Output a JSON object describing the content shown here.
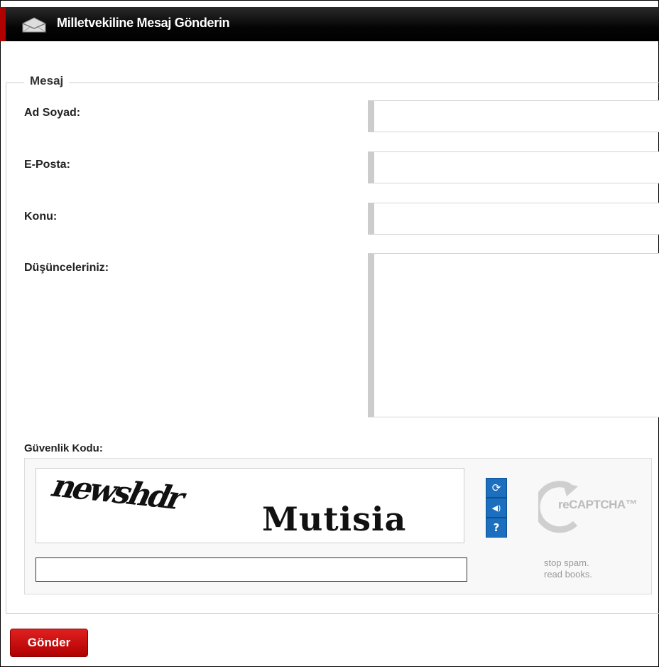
{
  "header": {
    "title": "Milletvekiline Mesaj Gönderin",
    "icon": "envelope-icon"
  },
  "form": {
    "legend": "Mesaj",
    "fields": [
      {
        "label": "Ad Soyad:",
        "value": "",
        "placeholder": ""
      },
      {
        "label": "E-Posta:",
        "value": "",
        "placeholder": ""
      },
      {
        "label": "Konu:",
        "value": "",
        "placeholder": ""
      },
      {
        "label": "Düşünceleriniz:",
        "value": "",
        "placeholder": ""
      }
    ],
    "captcha": {
      "label": "Güvenlik Kodu:",
      "word1": "newshdr",
      "word2": "Mutisia",
      "input_value": "",
      "buttons": [
        {
          "icon": "refresh-icon",
          "glyph": "⟳"
        },
        {
          "icon": "audio-icon",
          "glyph": "◀)"
        },
        {
          "icon": "help-icon",
          "glyph": "?"
        }
      ],
      "brand": "reCAPTCHA™",
      "slogan_line1": "stop spam.",
      "slogan_line2": "read books."
    },
    "submit_label": "Gönder"
  },
  "colors": {
    "accent": "#b00000",
    "button": "#d01010",
    "captcha_button": "#1c6fbf"
  }
}
